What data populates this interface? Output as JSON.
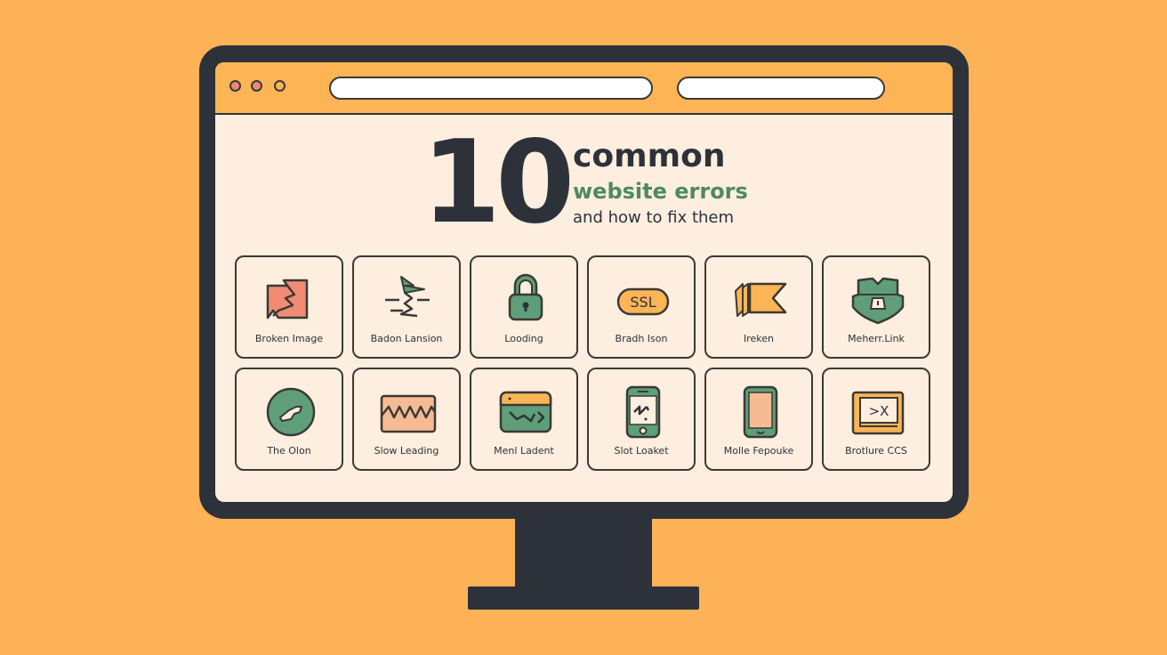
{
  "colors": {
    "background": "#FDB257",
    "bezel": "#2D323A",
    "screen": "#FDEEDF",
    "accent_orange": "#FDB455",
    "accent_green": "#5E9E78",
    "accent_coral": "#F28B74",
    "title_green": "#4E8A5C"
  },
  "browser": {
    "window_controls": [
      "close",
      "minimize",
      "maximize"
    ],
    "address_bar_value": "",
    "search_bar_value": ""
  },
  "hero": {
    "number": "10",
    "line1": "common",
    "line2": "website errors",
    "line3": "and how to fix them"
  },
  "cards": [
    {
      "label": "Broken Image",
      "icon": "broken-image-icon"
    },
    {
      "label": "Badon Lansion",
      "icon": "lightning-icon"
    },
    {
      "label": "Looding",
      "icon": "padlock-icon"
    },
    {
      "label": "Bradh Ison",
      "icon": "ssl-badge-icon",
      "icon_text": "SSL"
    },
    {
      "label": "Ireken",
      "icon": "broken-flag-icon"
    },
    {
      "label": "Meherr.Link",
      "icon": "shield-warning-icon"
    },
    {
      "label": "The Olon",
      "icon": "circle-cursor-icon"
    },
    {
      "label": "Slow Leading",
      "icon": "waveform-icon"
    },
    {
      "label": "Menl Ladent",
      "icon": "code-window-icon"
    },
    {
      "label": "Slot Loaket",
      "icon": "phone-question-icon"
    },
    {
      "label": "Molle Fepouke",
      "icon": "mobile-phone-icon"
    },
    {
      "label": "Brotlure CCS",
      "icon": "terminal-book-icon",
      "icon_text": ">X"
    }
  ]
}
